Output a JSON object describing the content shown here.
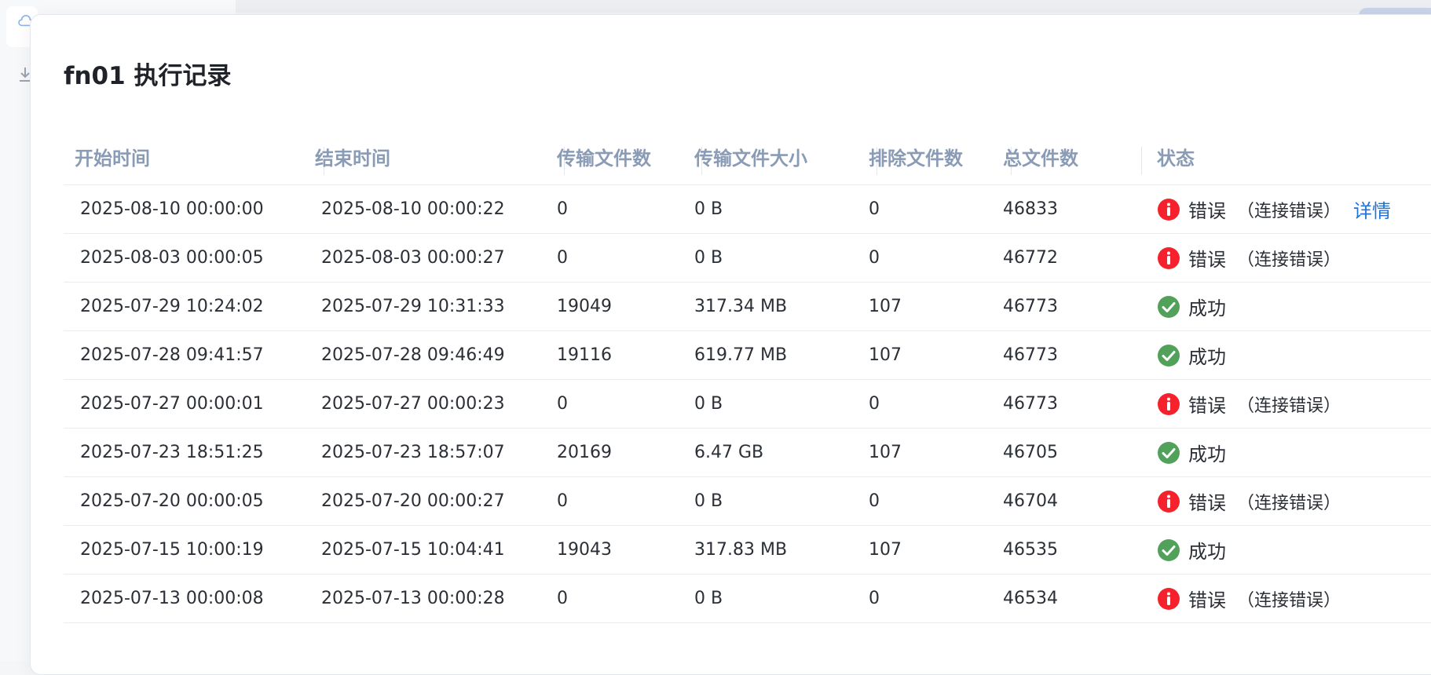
{
  "dialog": {
    "title": "fn01 执行记录"
  },
  "table": {
    "columns": [
      "开始时间",
      "结束时间",
      "传输文件数",
      "传输文件大小",
      "排除文件数",
      "总文件数",
      "状态"
    ],
    "rows": [
      {
        "start": "2025-08-10 00:00:00",
        "end": "2025-08-10 00:00:22",
        "files": "0",
        "size": "0 B",
        "excluded": "0",
        "total": "46833",
        "status": "错误",
        "reason": "（连接错误）",
        "details": "详情",
        "state": "error"
      },
      {
        "start": "2025-08-03 00:00:05",
        "end": "2025-08-03 00:00:27",
        "files": "0",
        "size": "0 B",
        "excluded": "0",
        "total": "46772",
        "status": "错误",
        "reason": "（连接错误）",
        "details": "",
        "state": "error"
      },
      {
        "start": "2025-07-29 10:24:02",
        "end": "2025-07-29 10:31:33",
        "files": "19049",
        "size": "317.34 MB",
        "excluded": "107",
        "total": "46773",
        "status": "成功",
        "reason": "",
        "details": "",
        "state": "success"
      },
      {
        "start": "2025-07-28 09:41:57",
        "end": "2025-07-28 09:46:49",
        "files": "19116",
        "size": "619.77 MB",
        "excluded": "107",
        "total": "46773",
        "status": "成功",
        "reason": "",
        "details": "",
        "state": "success"
      },
      {
        "start": "2025-07-27 00:00:01",
        "end": "2025-07-27 00:00:23",
        "files": "0",
        "size": "0 B",
        "excluded": "0",
        "total": "46773",
        "status": "错误",
        "reason": "（连接错误）",
        "details": "",
        "state": "error"
      },
      {
        "start": "2025-07-23 18:51:25",
        "end": "2025-07-23 18:57:07",
        "files": "20169",
        "size": "6.47 GB",
        "excluded": "107",
        "total": "46705",
        "status": "成功",
        "reason": "",
        "details": "",
        "state": "success"
      },
      {
        "start": "2025-07-20 00:00:05",
        "end": "2025-07-20 00:00:27",
        "files": "0",
        "size": "0 B",
        "excluded": "0",
        "total": "46704",
        "status": "错误",
        "reason": "（连接错误）",
        "details": "",
        "state": "error"
      },
      {
        "start": "2025-07-15 10:00:19",
        "end": "2025-07-15 10:04:41",
        "files": "19043",
        "size": "317.83 MB",
        "excluded": "107",
        "total": "46535",
        "status": "成功",
        "reason": "",
        "details": "",
        "state": "success"
      },
      {
        "start": "2025-07-13 00:00:08",
        "end": "2025-07-13 00:00:28",
        "files": "0",
        "size": "0 B",
        "excluded": "0",
        "total": "46534",
        "status": "错误",
        "reason": "（连接错误）",
        "details": "",
        "state": "error"
      }
    ]
  },
  "colors": {
    "error": "#f5222d",
    "success": "#52a15a",
    "link": "#1f73d6",
    "header_text": "#8a9bb5"
  },
  "icons": {
    "error": "error-icon",
    "success": "success-check-icon"
  }
}
